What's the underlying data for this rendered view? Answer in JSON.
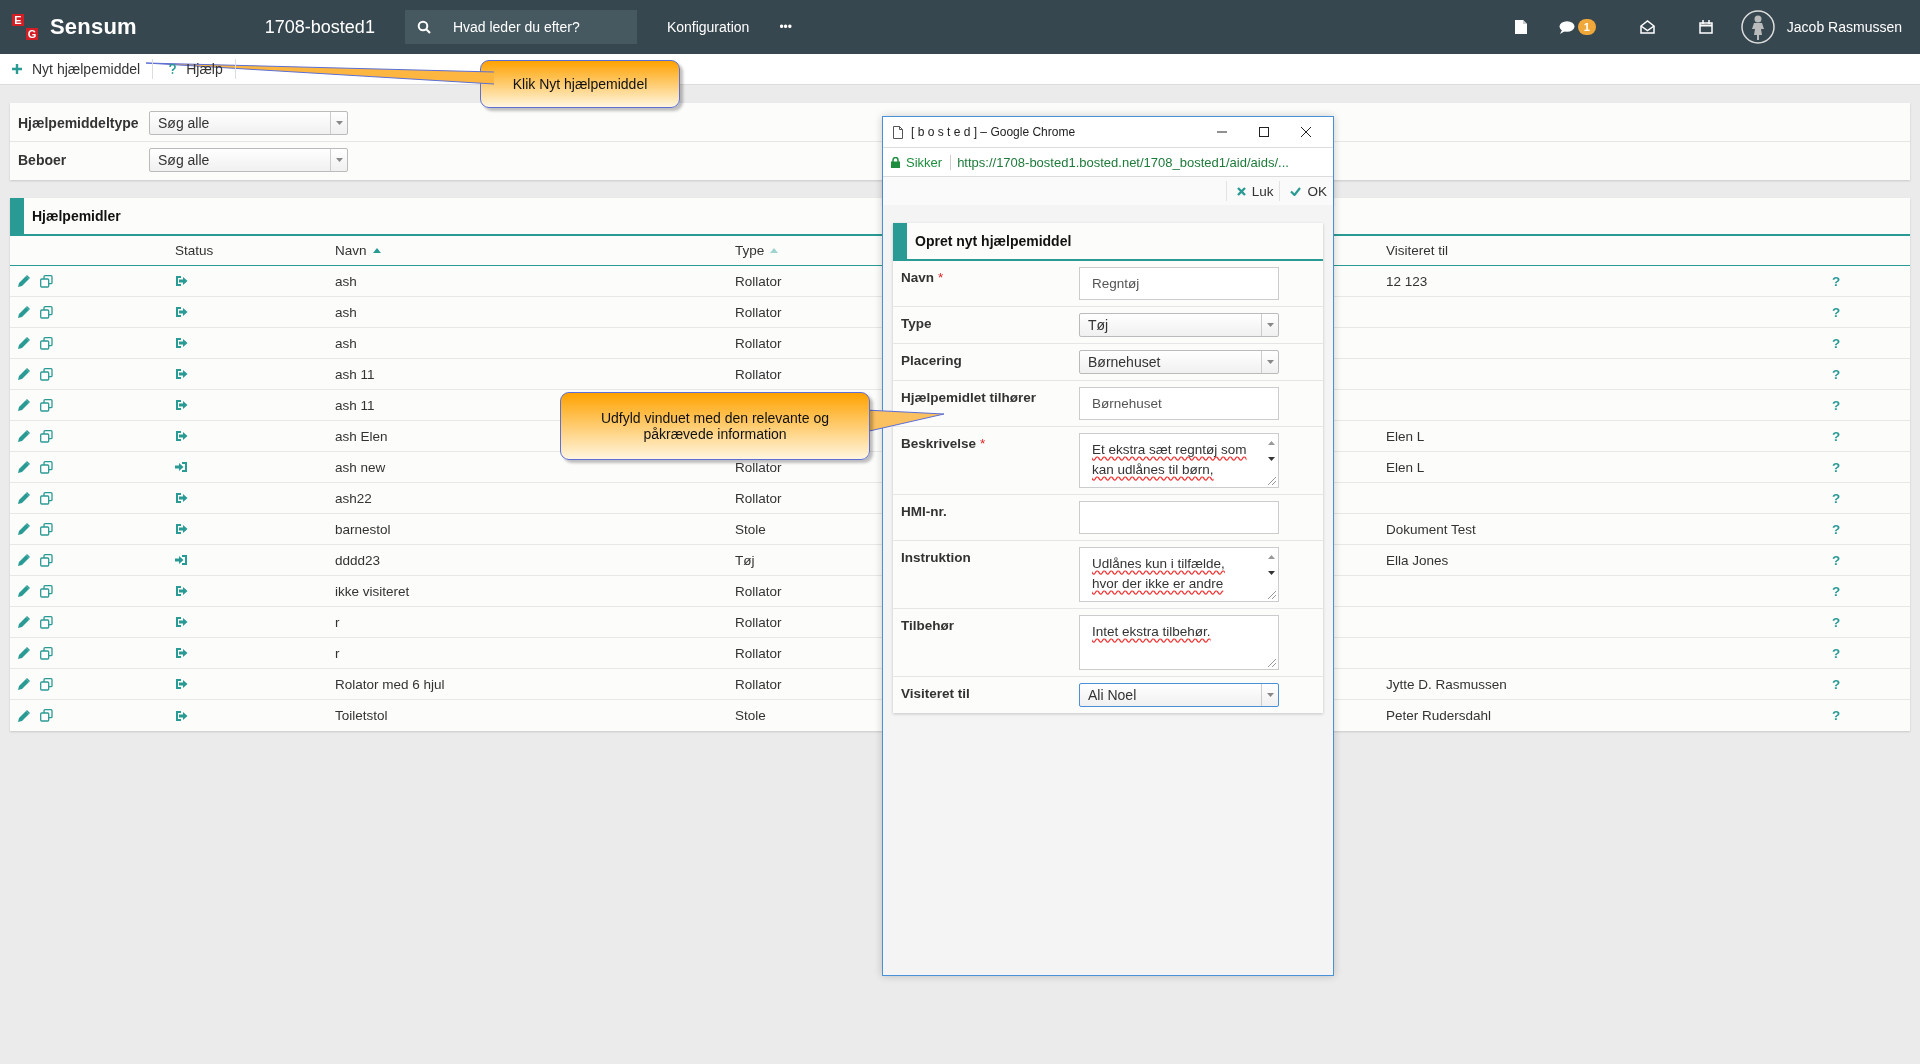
{
  "topbar": {
    "logo_letters": [
      "E",
      "G"
    ],
    "brand": "Sensum",
    "site": "1708-bosted1",
    "search": {
      "placeholder": "Hvad leder du efter?"
    },
    "menu": "Konfiguration",
    "more": "•••",
    "chat_badge": "1",
    "user": "Jacob Rasmussen"
  },
  "toolbar": [
    {
      "label": "Nyt hjælpemiddel"
    },
    {
      "label": "Hjælp"
    }
  ],
  "filters": [
    {
      "label": "Hjælpemiddeltype",
      "value": "Søg alle"
    },
    {
      "label": "Beboer",
      "value": "Søg alle"
    }
  ],
  "table": {
    "title": "Hjælpemidler",
    "columns": [
      {
        "label": "Status",
        "kind": "plain"
      },
      {
        "label": "Navn",
        "kind": "sorted"
      },
      {
        "label": "Type",
        "kind": "sortable"
      },
      {
        "label": "Visiteret til",
        "kind": "plain"
      }
    ],
    "rows": [
      {
        "kind": "out",
        "name": "ash",
        "type": "Rollator",
        "visited_to": "12 123",
        "help": "?"
      },
      {
        "kind": "out",
        "name": "ash",
        "type": "Rollator",
        "help": "?"
      },
      {
        "kind": "out",
        "name": "ash",
        "type": "Rollator",
        "help": "?"
      },
      {
        "kind": "out",
        "name": "ash 11",
        "type": "Rollator",
        "help": "?"
      },
      {
        "kind": "out",
        "name": "ash 11",
        "help": "?"
      },
      {
        "kind": "out",
        "name": "ash Elen",
        "visited_to": "Elen L",
        "help": "?"
      },
      {
        "kind": "in",
        "name": "ash new",
        "type": "Rollator",
        "visited_to": "Elen L",
        "help": "?"
      },
      {
        "kind": "out",
        "name": "ash22",
        "type": "Rollator",
        "help": "?"
      },
      {
        "kind": "out",
        "name": "barnestol",
        "type": "Stole",
        "visited_to": "Dokument Test",
        "help": "?"
      },
      {
        "kind": "in",
        "name": "dddd23",
        "type": "Tøj",
        "visited_to": "Ella Jones",
        "help": "?"
      },
      {
        "kind": "out",
        "name": "ikke visiteret",
        "type": "Rollator",
        "help": "?"
      },
      {
        "kind": "out",
        "name": "r",
        "type": "Rollator",
        "help": "?"
      },
      {
        "kind": "out",
        "name": "r",
        "type": "Rollator",
        "help": "?"
      },
      {
        "kind": "out",
        "name": "Rolator med 6 hjul",
        "type": "Rollator",
        "visited_to": "Jytte D. Rasmussen",
        "help": "?"
      },
      {
        "kind": "out",
        "name": "Toiletstol",
        "type": "Stole",
        "visited_to": "Peter Rudersdahl",
        "help": "?"
      }
    ]
  },
  "popup": {
    "title": "[ b o s t e d ] – Google Chrome",
    "secure": "Sikker",
    "url": "https://1708-bosted1.bosted.net/1708_bosted1/aid/aids/...",
    "actions": [
      {
        "label": "Luk"
      },
      {
        "label": "OK"
      }
    ],
    "form_title": "Opret nyt hjælpemiddel",
    "fields": [
      {
        "kind": "text",
        "label": "Navn",
        "required_mark": "*",
        "value": "Regntøj",
        "focused": false
      },
      {
        "kind": "select",
        "label": "Type",
        "value": "Tøj",
        "focused": false
      },
      {
        "kind": "select",
        "label": "Placering",
        "value": "Børnehuset",
        "focused": false
      },
      {
        "kind": "text",
        "label": "Hjælpemidlet tilhører",
        "value": "Børnehuset",
        "focused": false
      },
      {
        "kind": "textarea",
        "label": "Beskrivelse",
        "required_mark": "*",
        "value": "Et ekstra sæt regntøj som kan udlånes til børn,",
        "focused": false
      },
      {
        "kind": "text",
        "label": "HMI-nr.",
        "focused": false
      },
      {
        "kind": "textarea",
        "label": "Instruktion",
        "value": "Udlånes kun i tilfælde, hvor der ikke er andre",
        "focused": false
      },
      {
        "kind": "textarea",
        "label": "Tilbehør",
        "value": "Intet ekstra tilbehør.",
        "focused": false
      },
      {
        "kind": "select",
        "label": "Visiteret til",
        "value": "Ali Noel",
        "focused": true
      }
    ]
  },
  "callouts": [
    {
      "text": "Klik Nyt hjælpemiddel"
    },
    {
      "text": "Udfyld vinduet med den relevante og påkrævede information"
    }
  ]
}
